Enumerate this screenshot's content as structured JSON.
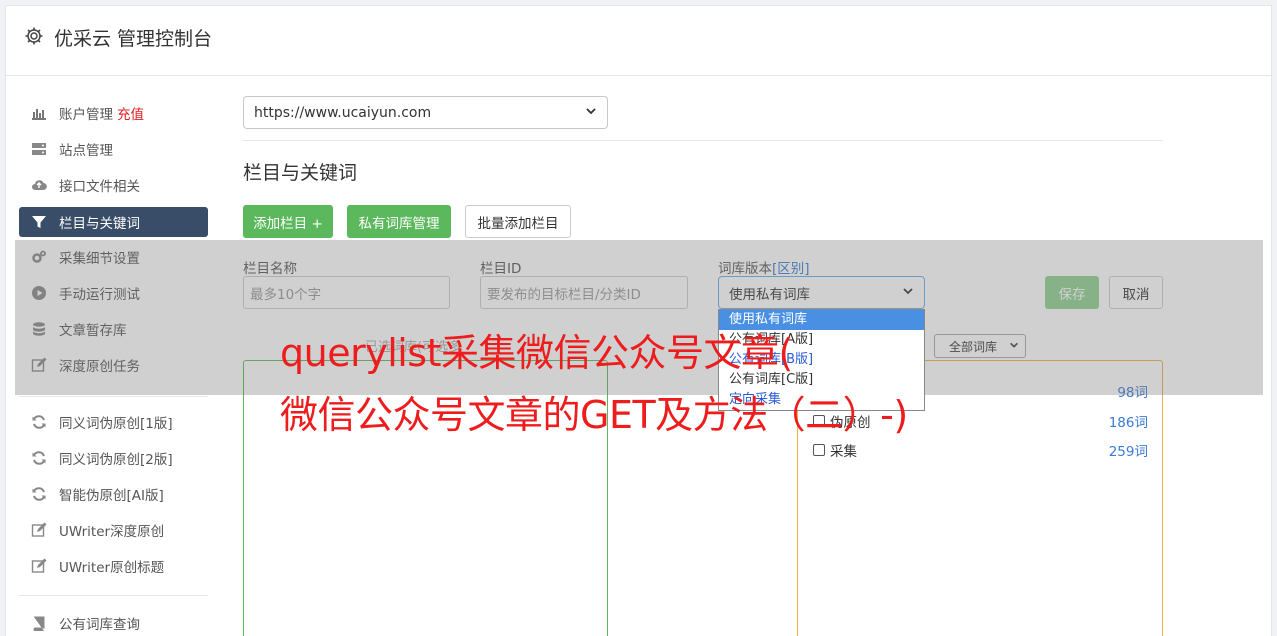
{
  "header": {
    "title": "优采云 管理控制台",
    "icon": "gear-icon"
  },
  "sidebar": {
    "items": [
      {
        "label": "账户管理",
        "badge": "充值",
        "icon": "bar-chart-icon"
      },
      {
        "label": "站点管理",
        "icon": "server-icon"
      },
      {
        "label": "接口文件相关",
        "icon": "cloud-upload-icon"
      },
      {
        "label": "栏目与关键词",
        "icon": "filter-icon"
      },
      {
        "label": "采集细节设置",
        "icon": "gears-icon"
      },
      {
        "label": "手动运行测试",
        "icon": "play-circle-icon"
      },
      {
        "label": "文章暂存库",
        "icon": "database-icon"
      },
      {
        "label": "深度原创任务",
        "icon": "edit-icon"
      },
      {
        "label": "同义词伪原创[1版]",
        "icon": "refresh-icon"
      },
      {
        "label": "同义词伪原创[2版]",
        "icon": "refresh-icon"
      },
      {
        "label": "智能伪原创[AI版]",
        "icon": "refresh-icon"
      },
      {
        "label": "UWriter深度原创",
        "icon": "edit-icon"
      },
      {
        "label": "UWriter原创标题",
        "icon": "edit-icon"
      },
      {
        "label": "公有词库查询",
        "icon": "book-icon"
      }
    ]
  },
  "site_select": {
    "value": "https://www.ucaiyun.com"
  },
  "section": {
    "title": "栏目与关键词"
  },
  "buttons": {
    "add_column": "添加栏目 +",
    "private_lib": "私有词库管理",
    "batch_add": "批量添加栏目",
    "save": "保存",
    "cancel": "取消"
  },
  "form": {
    "name_label": "栏目名称",
    "name_placeholder": "最多10个字",
    "id_label": "栏目ID",
    "id_placeholder": "要发布的目标栏目/分类ID",
    "lib_label": "词库版本",
    "lib_diff": "[区别]",
    "lib_value": "使用私有词库",
    "lib_options": [
      "使用私有词库",
      "公有词库[A版]",
      "公有词库[B版]",
      "公有词库[C版]",
      "定向采集"
    ]
  },
  "panels": {
    "left_hint": "已选词库(可选多",
    "filter_value": "全部词库",
    "words": [
      {
        "label": "",
        "count": "98词"
      },
      {
        "label": "伪原创",
        "count": "186词"
      },
      {
        "label": "采集",
        "count": "259词"
      }
    ]
  },
  "headline": {
    "line1": "querylist采集微信公众号文章(",
    "line2": "微信公众号文章的GET及方法（二）-)"
  },
  "colors": {
    "accent": "#3a4d68",
    "green": "#5cb85c",
    "headline": "#ee1c1c",
    "link": "#3a7bd5"
  }
}
